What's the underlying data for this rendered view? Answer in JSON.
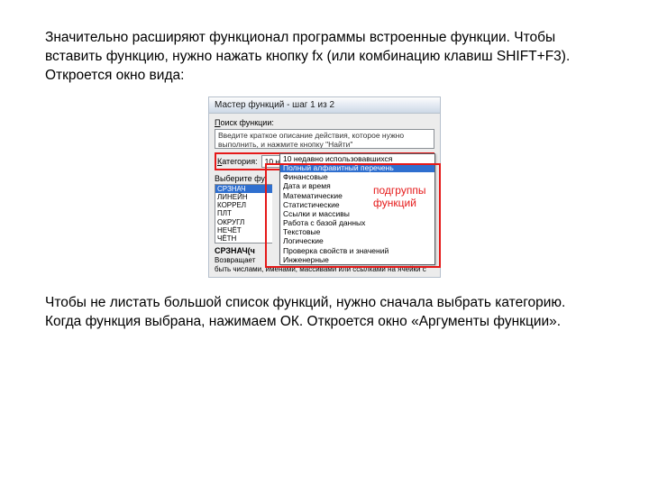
{
  "intro": "Значительно расширяют функционал программы встроенные функции. Чтобы вставить функцию, нужно нажать кнопку fx (или комбинацию клавиш SHIFT+F3). Откроется окно вида:",
  "dialog": {
    "title": "Мастер функций - шаг 1 из 2",
    "search_label_pre": "П",
    "search_label": "оиск функции:",
    "search_text": "Введите краткое описание действия, которое нужно выполнить, и нажмите кнопку \"Найти\"",
    "category_label_pre": "К",
    "category_label": "атегория:",
    "category_value": "10 недавно использовавшихся",
    "select_label": "Выберите фу",
    "functions": [
      "СРЗНАЧ",
      "ЛИНЕЙН",
      "КОРРЕЛ",
      "ПЛТ",
      "ОКРУГЛ",
      "НЕЧЁТ",
      "ЧЁТН"
    ],
    "syntax": "СРЗНАЧ(ч",
    "return_desc": "Возвращает",
    "return_desc2": "быть числами, именами, массивами или ссылками на ячейки с"
  },
  "dropdown": {
    "items": [
      "10 недавно использовавшихся",
      "Полный алфавитный перечень",
      "Финансовые",
      "Дата и время",
      "Математические",
      "Статистические",
      "Ссылки и массивы",
      "Работа с базой данных",
      "Текстовые",
      "Логические",
      "Проверка свойств и значений",
      "Инженерные"
    ],
    "selected_index": 1
  },
  "annotation_l1": "подгруппы",
  "annotation_l2": "функций",
  "outro1": "Чтобы не листать большой список функций, нужно сначала выбрать категорию.",
  "outro2": "Когда функция выбрана, нажимаем ОК. Откроется окно «Аргументы функции»."
}
